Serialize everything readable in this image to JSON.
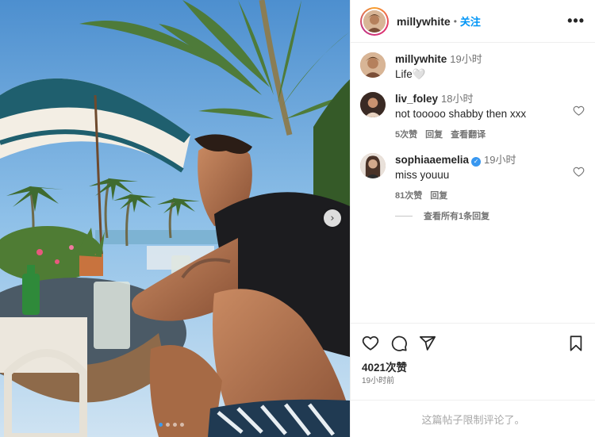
{
  "post": {
    "author": "millywhite",
    "follow_label": "关注",
    "separator": "•",
    "more_glyph": "•••",
    "next_glyph": "›",
    "carousel": {
      "total": 4,
      "active_index": 0
    },
    "caption": {
      "user": "millywhite",
      "time": "19小时",
      "text": "Life🤍"
    }
  },
  "comments": [
    {
      "user": "liv_foley",
      "verified": false,
      "time": "18小时",
      "text": "not tooooo shabby then xxx",
      "likes": "5次赞",
      "reply_label": "回复",
      "translate_label": "查看翻译"
    },
    {
      "user": "sophiaaemelia",
      "verified": true,
      "time": "19小时",
      "text": "miss youuu",
      "likes": "81次赞",
      "reply_label": "回复",
      "view_replies_label": "查看所有1条回复"
    }
  ],
  "actions": {
    "likes_count": "4021次赞",
    "post_time": "19小时前",
    "icons": [
      "heart-icon",
      "comment-icon",
      "share-icon",
      "bookmark-icon"
    ]
  },
  "footer": {
    "comments_limited": "这篇帖子限制评论了。"
  },
  "colors": {
    "link_blue": "#0095f6",
    "verified_blue": "#3897f0",
    "muted": "#737373"
  }
}
